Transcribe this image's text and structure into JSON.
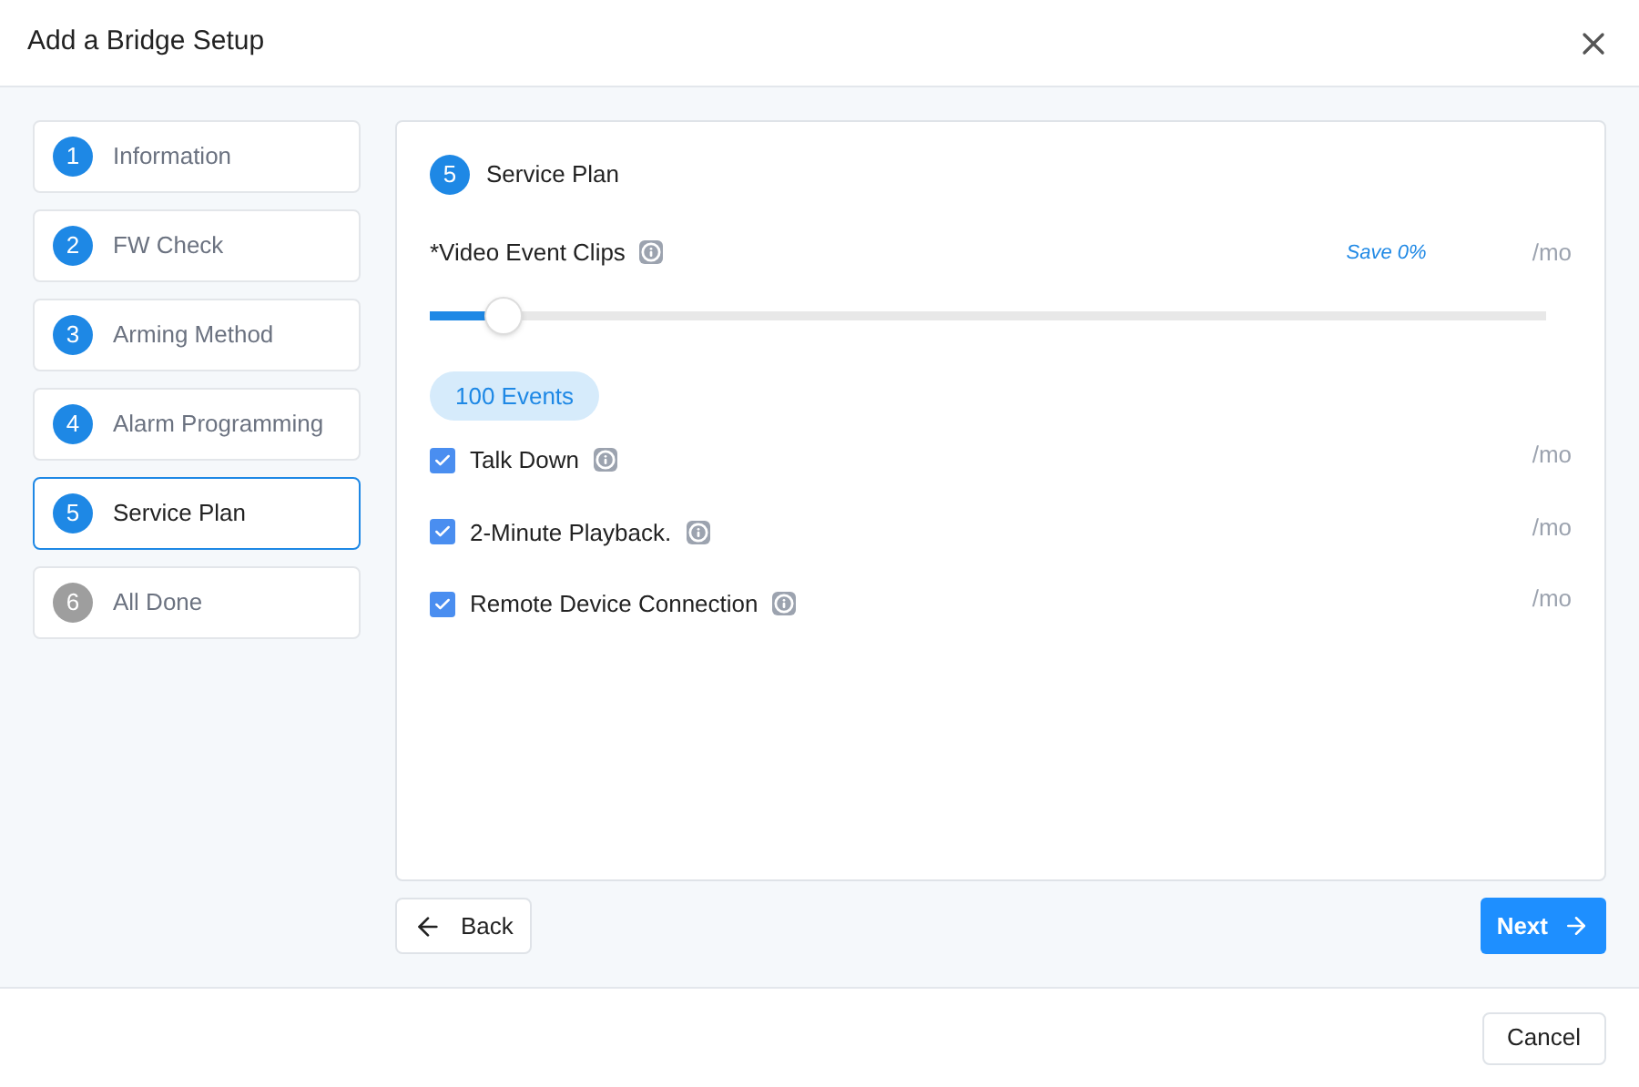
{
  "dialog": {
    "title": "Add a Bridge Setup"
  },
  "steps": [
    {
      "number": "1",
      "label": "Information",
      "selected": false,
      "enabled": true
    },
    {
      "number": "2",
      "label": "FW Check",
      "selected": false,
      "enabled": true
    },
    {
      "number": "3",
      "label": "Arming Method",
      "selected": false,
      "enabled": true
    },
    {
      "number": "4",
      "label": "Alarm Programming",
      "selected": false,
      "enabled": true
    },
    {
      "number": "5",
      "label": "Service Plan",
      "selected": true,
      "enabled": true
    },
    {
      "number": "6",
      "label": "All Done",
      "selected": false,
      "enabled": false
    }
  ],
  "panel": {
    "number": "5",
    "title": "Service Plan",
    "video_clips": {
      "label": "*Video Event Clips",
      "savings": "Save 0%",
      "price": "/mo",
      "level": 0.065,
      "value": "100 Events"
    },
    "options": [
      {
        "label": "Talk Down",
        "checked": true,
        "price": "/mo"
      },
      {
        "label": "2-Minute Playback.",
        "checked": true,
        "price": "/mo"
      },
      {
        "label": "Remote Device Connection",
        "checked": true,
        "price": "/mo"
      }
    ]
  },
  "back_button": "Back",
  "next_button": "Next",
  "cancel_button": "Cancel"
}
